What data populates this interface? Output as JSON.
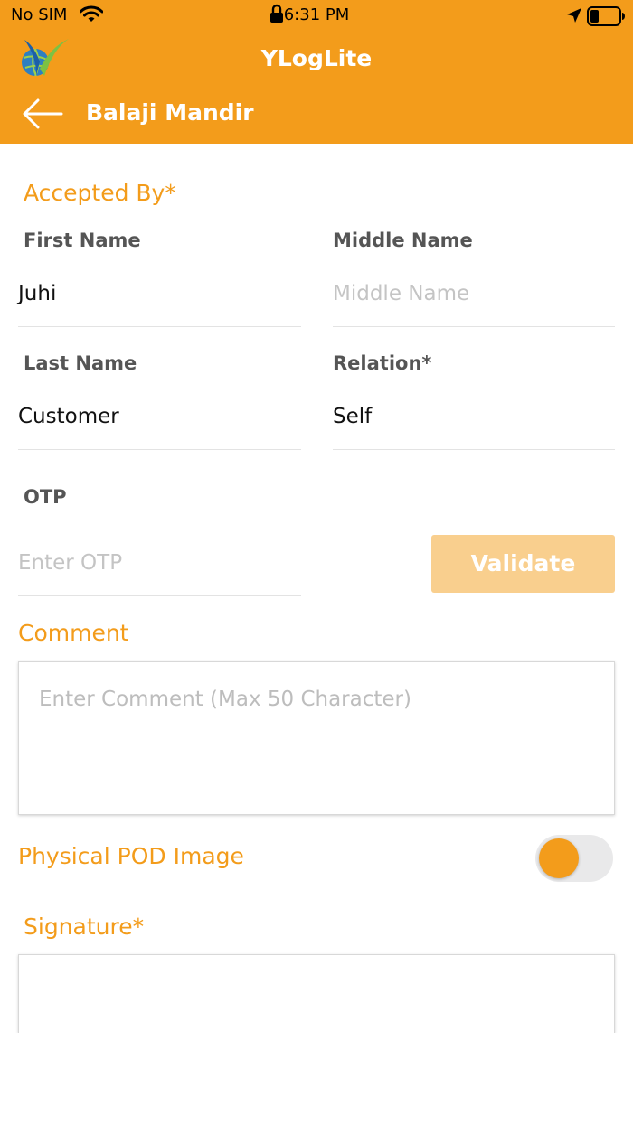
{
  "status_bar": {
    "carrier": "No SIM",
    "time": "6:31 PM"
  },
  "header": {
    "app_title": "YLogLite",
    "screen_title": "Balaji Mandir",
    "accent_color": "#F39C1B"
  },
  "form": {
    "accepted_by_label": "Accepted By*",
    "first_name": {
      "label": "First Name",
      "value": "Juhi"
    },
    "middle_name": {
      "label": "Middle Name",
      "placeholder": "Middle Name"
    },
    "last_name": {
      "label": "Last Name",
      "value": "Customer"
    },
    "relation": {
      "label": "Relation*",
      "value": "Self"
    },
    "otp": {
      "label": "OTP",
      "placeholder": "Enter OTP"
    },
    "validate_label": "Validate",
    "comment": {
      "label": "Comment",
      "placeholder": "Enter Comment (Max 50 Character)"
    },
    "physical_pod": {
      "label": "Physical POD Image",
      "enabled": false
    },
    "signature_label": "Signature*"
  }
}
